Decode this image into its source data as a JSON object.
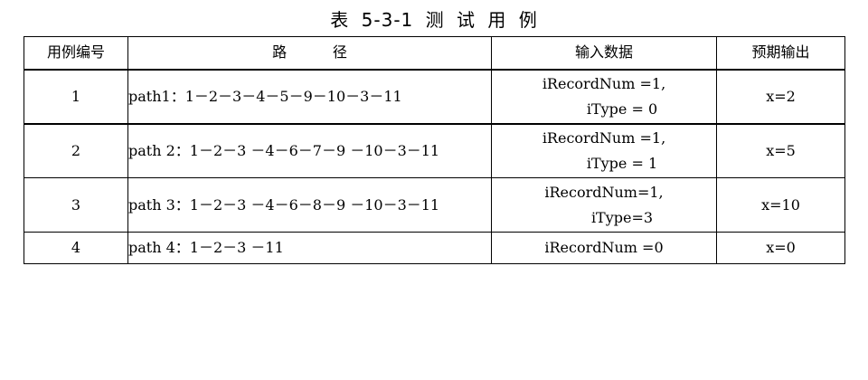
{
  "title": "表 5-3-1   测  试  用  例",
  "headers": [
    "用例编号",
    "路          径",
    "输入数据",
    "预期输出"
  ],
  "rows": [
    {
      "id": "1",
      "path": "path1：1－2－3－4－5－9－10－3－11",
      "input_line1": "iRecordNum =1,",
      "input_line2": "iType = 0",
      "output": "x=2"
    },
    {
      "id": "2",
      "path": "path 2：1－2－3 －4－6－7－9 －10－3－11",
      "input_line1": "iRecordNum =1,",
      "input_line2": "iType = 1",
      "output": "x=5"
    },
    {
      "id": "3",
      "path": "path 3：1－2－3 －4－6－8－9 －10－3－11",
      "input_line1": "iRecordNum=1,",
      "input_line2": "iType=3",
      "output": "x=10"
    },
    {
      "id": "4",
      "path": "path 4：1－2－3 －11",
      "input_line1": "iRecordNum =0",
      "input_line2": "",
      "output": "x=0"
    }
  ]
}
